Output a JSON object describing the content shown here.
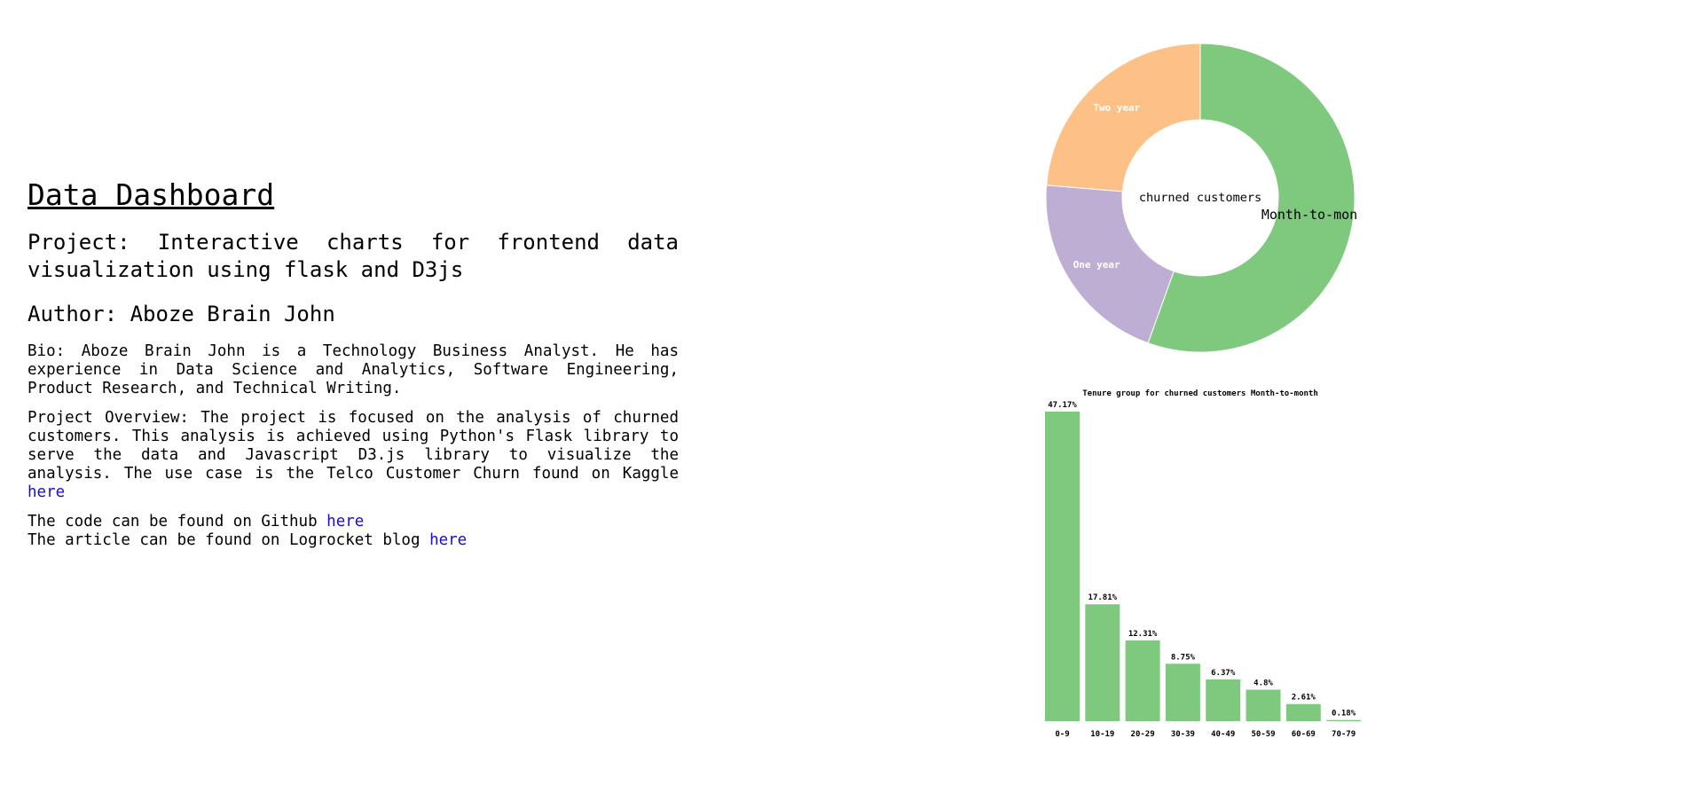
{
  "header": {
    "title": "Data Dashboard"
  },
  "info": {
    "project": "Project: Interactive charts for frontend data visualization using flask and D3js",
    "author": "Author: Aboze Brain John",
    "bio": "Bio: Aboze Brain John is a Technology Business Analyst. He has experience in Data Science and Analytics, Software Engineering, Product Research, and Technical Writing.",
    "overview": "Project Overview: The project is focused on the analysis of churned customers. This analysis is achieved using Python's Flask library to serve the data and Javascript D3.js library to visualize the analysis. The use case is the Telco Customer Churn found on Kaggle",
    "kaggle_link": "here",
    "github_text": "The code can be found on Github",
    "github_link": "here",
    "article_text": "The article can be found on Logrocket blog",
    "article_link": "here"
  },
  "colors": {
    "month_to_month": "#7fc97f",
    "one_year": "#beaed4",
    "two_year": "#fdc086",
    "bar": "#7fc97f",
    "link": "#1a0dcc"
  },
  "chart_data": [
    {
      "type": "pie",
      "title": "churned customers",
      "categories": [
        "Month-to-month",
        "One year",
        "Two year"
      ],
      "values": [
        55.5,
        20.8,
        23.7
      ],
      "displayed_labels": [
        "Month-to-mon",
        "One year",
        "Two year"
      ]
    },
    {
      "type": "bar",
      "title": "Tenure group for churned customers Month-to-month",
      "categories": [
        "0-9",
        "10-19",
        "20-29",
        "30-39",
        "40-49",
        "50-59",
        "60-69",
        "70-79"
      ],
      "values": [
        47.17,
        17.81,
        12.31,
        8.75,
        6.37,
        4.8,
        2.61,
        0.18
      ],
      "value_labels": [
        "47.17%",
        "17.81%",
        "12.31%",
        "8.75%",
        "6.37%",
        "4.8%",
        "2.61%",
        "0.18%"
      ],
      "ylim": [
        0,
        47.17
      ]
    }
  ]
}
